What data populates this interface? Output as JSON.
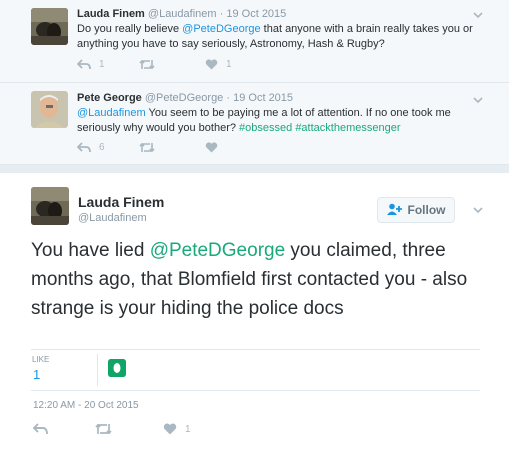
{
  "replies": [
    {
      "author_name": "Lauda Finem",
      "handle": "@Laudafinem",
      "separator": "·",
      "date": "19 Oct 2015",
      "text_parts": [
        {
          "text": "Do you really believe ",
          "kind": "plain"
        },
        {
          "text": "@PeteDGeorge",
          "kind": "mention"
        },
        {
          "text": " that anyone with a brain really takes you or anything you have to say seriously, Astronomy, Hash & Rugby?",
          "kind": "plain"
        }
      ],
      "reply_count": "1",
      "retweet_count": "",
      "like_count": "1"
    },
    {
      "author_name": "Pete George",
      "handle": "@PeteDGeorge",
      "separator": "·",
      "date": "19 Oct 2015",
      "text_parts": [
        {
          "text": "@Laudafinem",
          "kind": "mention"
        },
        {
          "text": " You seem to be paying me a lot of attention. If no one took me seriously why would you bother? ",
          "kind": "plain"
        },
        {
          "text": "#obsessed",
          "kind": "hashtag"
        },
        {
          "text": " ",
          "kind": "plain"
        },
        {
          "text": "#attackthemessenger",
          "kind": "hashtag"
        }
      ],
      "reply_count": "6",
      "retweet_count": "",
      "like_count": ""
    }
  ],
  "main_tweet": {
    "author_name": "Lauda Finem",
    "handle": "@Laudafinem",
    "follow_label": "Follow",
    "text_parts": [
      {
        "text": "You have lied ",
        "kind": "plain"
      },
      {
        "text": "@PeteDGeorge",
        "kind": "mention"
      },
      {
        "text": " you claimed, three months ago, that Blomfield first contacted you - also strange is your hiding the police docs",
        "kind": "plain"
      }
    ],
    "likes_label": "LIKE",
    "likes_count": "1",
    "timestamp": "12:20 AM - 20 Oct 2015",
    "like_count_action": "1"
  },
  "colors": {
    "link": "#1b95e0",
    "mention_green": "#19a97a",
    "icon_gray": "#aab8c2",
    "meta_gray": "#8899a6"
  },
  "icons": [
    "reply-icon",
    "retweet-icon",
    "heart-icon",
    "chevron-down-icon",
    "add-person-icon"
  ]
}
